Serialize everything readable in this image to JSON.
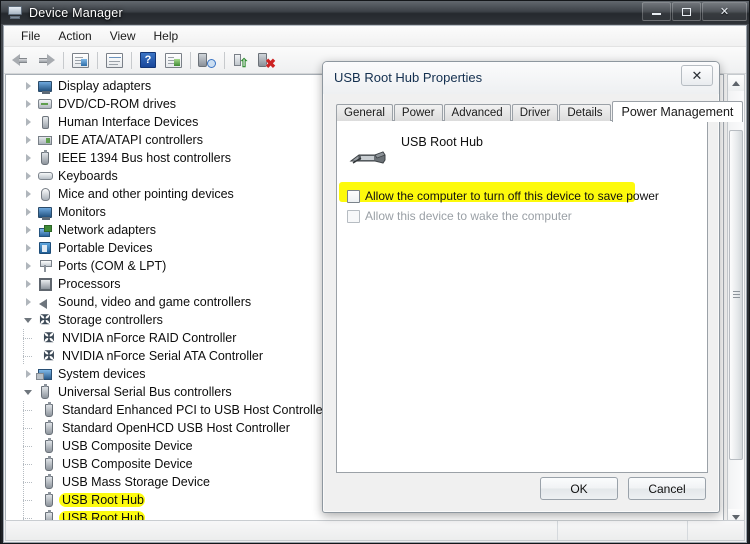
{
  "window": {
    "title": "Device Manager",
    "icon": "device-manager-icon",
    "controls": {
      "minimize": "–",
      "maximize": "□",
      "close": "✕"
    }
  },
  "menubar": {
    "items": [
      {
        "label": "File"
      },
      {
        "label": "Action"
      },
      {
        "label": "View"
      },
      {
        "label": "Help"
      }
    ]
  },
  "toolbar": {
    "buttons": [
      {
        "name": "back-button",
        "icon": "arrow-left-icon",
        "title": "Back"
      },
      {
        "name": "forward-button",
        "icon": "arrow-right-icon",
        "title": "Forward"
      },
      {
        "name": "show-hide-console-tree-button",
        "icon": "console-tree-icon",
        "title": "Show/Hide Console Tree"
      },
      {
        "name": "properties-button",
        "icon": "properties-icon",
        "title": "Properties"
      },
      {
        "name": "help-button",
        "icon": "help-icon",
        "glyph": "?",
        "title": "Help"
      },
      {
        "name": "view-list-button",
        "icon": "list-view-icon",
        "title": "View"
      },
      {
        "name": "scan-hardware-changes-button",
        "icon": "scan-hardware-icon",
        "title": "Scan for hardware changes"
      },
      {
        "name": "update-driver-button",
        "icon": "update-driver-icon",
        "title": "Update Driver Software"
      },
      {
        "name": "uninstall-device-button",
        "icon": "uninstall-device-icon",
        "title": "Uninstall"
      }
    ]
  },
  "tree": {
    "nodes": [
      {
        "label": "Display adapters",
        "icon": "monitor-icon",
        "state": "collapsed",
        "level": 1,
        "highlight": false
      },
      {
        "label": "DVD/CD-ROM drives",
        "icon": "disc-drive-icon",
        "state": "collapsed",
        "level": 1,
        "highlight": false
      },
      {
        "label": "Human Interface Devices",
        "icon": "hid-icon",
        "state": "collapsed",
        "level": 1,
        "highlight": false
      },
      {
        "label": "IDE ATA/ATAPI controllers",
        "icon": "ide-controller-icon",
        "state": "collapsed",
        "level": 1,
        "highlight": false
      },
      {
        "label": "IEEE 1394 Bus host controllers",
        "icon": "firewire-icon",
        "state": "collapsed",
        "level": 1,
        "highlight": false
      },
      {
        "label": "Keyboards",
        "icon": "keyboard-icon",
        "state": "collapsed",
        "level": 1,
        "highlight": false
      },
      {
        "label": "Mice and other pointing devices",
        "icon": "mouse-icon",
        "state": "collapsed",
        "level": 1,
        "highlight": false
      },
      {
        "label": "Monitors",
        "icon": "monitor-icon",
        "state": "collapsed",
        "level": 1,
        "highlight": false
      },
      {
        "label": "Network adapters",
        "icon": "network-adapter-icon",
        "state": "collapsed",
        "level": 1,
        "highlight": false
      },
      {
        "label": "Portable Devices",
        "icon": "portable-device-icon",
        "state": "collapsed",
        "level": 1,
        "highlight": false
      },
      {
        "label": "Ports (COM & LPT)",
        "icon": "port-icon",
        "state": "collapsed",
        "level": 1,
        "highlight": false
      },
      {
        "label": "Processors",
        "icon": "processor-icon",
        "state": "collapsed",
        "level": 1,
        "highlight": false
      },
      {
        "label": "Sound, video and game controllers",
        "icon": "sound-icon",
        "state": "collapsed",
        "level": 1,
        "highlight": false
      },
      {
        "label": "Storage controllers",
        "icon": "storage-controller-icon",
        "state": "expanded",
        "level": 1,
        "highlight": false
      },
      {
        "label": "NVIDIA nForce RAID Controller",
        "icon": "storage-controller-icon",
        "state": "leaf",
        "level": 2,
        "highlight": false
      },
      {
        "label": "NVIDIA nForce Serial ATA Controller",
        "icon": "storage-controller-icon",
        "state": "leaf",
        "level": 2,
        "highlight": false
      },
      {
        "label": "System devices",
        "icon": "system-device-icon",
        "state": "collapsed",
        "level": 1,
        "highlight": false
      },
      {
        "label": "Universal Serial Bus controllers",
        "icon": "usb-icon",
        "state": "expanded",
        "level": 1,
        "highlight": false
      },
      {
        "label": "Standard Enhanced PCI to USB Host Controller",
        "icon": "usb-icon",
        "state": "leaf",
        "level": 2,
        "highlight": false
      },
      {
        "label": "Standard OpenHCD USB Host Controller",
        "icon": "usb-icon",
        "state": "leaf",
        "level": 2,
        "highlight": false
      },
      {
        "label": "USB Composite Device",
        "icon": "usb-icon",
        "state": "leaf",
        "level": 2,
        "highlight": false
      },
      {
        "label": "USB Composite Device",
        "icon": "usb-icon",
        "state": "leaf",
        "level": 2,
        "highlight": false
      },
      {
        "label": "USB Mass Storage Device",
        "icon": "usb-icon",
        "state": "leaf",
        "level": 2,
        "highlight": false
      },
      {
        "label": "USB Root Hub",
        "icon": "usb-icon",
        "state": "leaf",
        "level": 2,
        "highlight": true
      },
      {
        "label": "USB Root Hub",
        "icon": "usb-icon",
        "state": "leaf",
        "level": 2,
        "highlight": true
      }
    ]
  },
  "scrollbar": {
    "up_arrow": "scroll-up-arrow",
    "down_arrow": "scroll-down-arrow",
    "thumb": "scroll-thumb"
  },
  "statusbar": {
    "cells": [
      "",
      "",
      ""
    ]
  },
  "dialog": {
    "title": "USB Root Hub Properties",
    "close_glyph": "✕",
    "tabs": [
      {
        "label": "General",
        "active": false
      },
      {
        "label": "Power",
        "active": false
      },
      {
        "label": "Advanced",
        "active": false
      },
      {
        "label": "Driver",
        "active": false
      },
      {
        "label": "Details",
        "active": false
      },
      {
        "label": "Power Management",
        "active": true
      }
    ],
    "device": {
      "name": "USB Root Hub",
      "icon": "usb-plug-icon"
    },
    "checkboxes": [
      {
        "label": "Allow the computer to turn off this device to save power",
        "checked": false,
        "disabled": false,
        "highlighted": true
      },
      {
        "label": "Allow this device to wake the computer",
        "checked": false,
        "disabled": true,
        "highlighted": false
      }
    ],
    "buttons": [
      {
        "label": "OK",
        "name": "ok-button"
      },
      {
        "label": "Cancel",
        "name": "cancel-button"
      }
    ]
  },
  "colors": {
    "highlight_yellow": "#fdfa0c",
    "titlebar_dark": "#2b2f34",
    "dialog_title_text": "#14304f",
    "accent_blue": "#19479a"
  }
}
